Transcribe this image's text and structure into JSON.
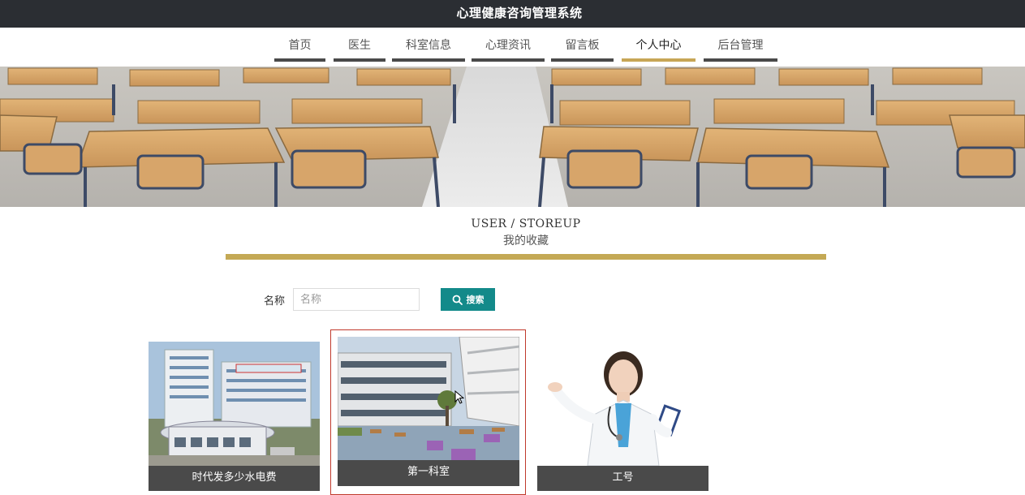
{
  "app": {
    "title": "心理健康咨询管理系统"
  },
  "nav": {
    "items": [
      {
        "label": "首页"
      },
      {
        "label": "医生"
      },
      {
        "label": "科室信息"
      },
      {
        "label": "心理资讯"
      },
      {
        "label": "留言板"
      },
      {
        "label": "个人中心"
      },
      {
        "label": "后台管理"
      }
    ],
    "active": "个人中心"
  },
  "section": {
    "title_en": "USER / STOREUP",
    "title_cn": "我的收藏"
  },
  "search": {
    "label": "名称",
    "placeholder": "名称",
    "value": "",
    "button_label": "搜索"
  },
  "cards": [
    {
      "label": "时代发多少水电费",
      "image": "hospital-building-photo"
    },
    {
      "label": "第一科室",
      "image": "modern-campus-building-photo"
    },
    {
      "label": "工号",
      "image": "female-doctor-photo"
    }
  ],
  "colors": {
    "topbar": "#2b2e33",
    "accent_gold": "#c4a955",
    "button_teal": "#138a8a",
    "card_label_bg": "#4a4a4a",
    "selected_border": "#c0392b"
  }
}
